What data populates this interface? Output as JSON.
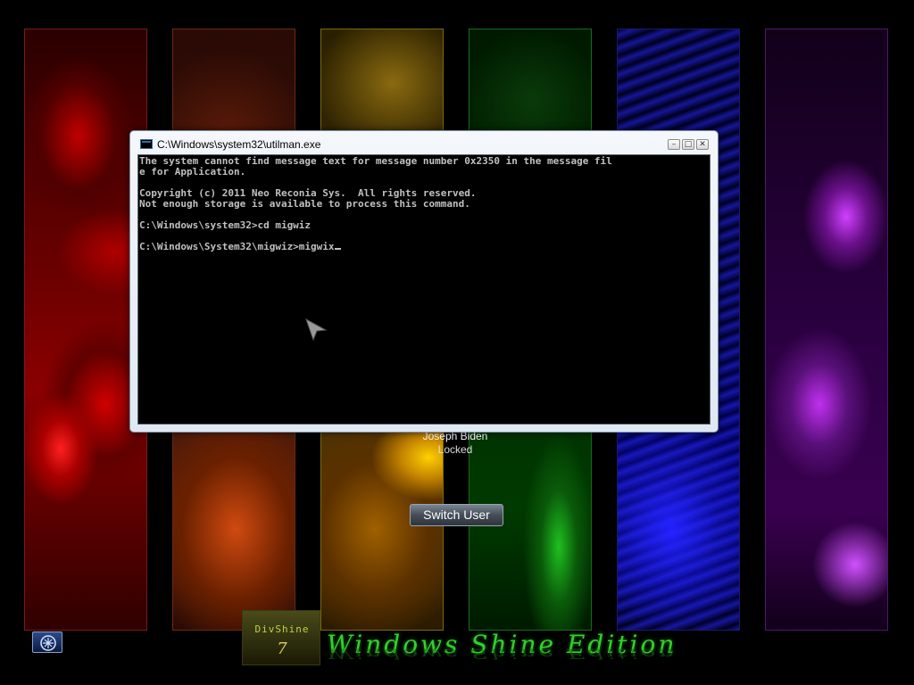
{
  "window": {
    "title": "C:\\Windows\\system32\\utilman.exe",
    "controls": {
      "minimize": "–",
      "maximize": "□",
      "close": "✕"
    }
  },
  "console": {
    "lines": [
      "The system cannot find message text for message number 0x2350 in the message fil",
      "e for Application.",
      "",
      "Copyright (c) 2011 Neo Reconia Sys.  All rights reserved.",
      "Not enough storage is available to process this command.",
      "",
      "C:\\Windows\\system32>cd migwiz",
      "",
      "C:\\Windows\\System32\\migwiz>migwix"
    ]
  },
  "user": {
    "name": "Joseph Biden",
    "status": "Locked"
  },
  "switch_user_label": "Switch User",
  "branding": {
    "logo_text": "DivShine",
    "logo_number": "7",
    "edition": "Windows Shine Edition"
  },
  "icons": {
    "accessibility": "ease-of-access-icon",
    "console": "console-icon",
    "pointer": "mouse-pointer-icon"
  },
  "colors": {
    "edition_green": "#33d02a",
    "console_text": "#c0c0c0"
  }
}
